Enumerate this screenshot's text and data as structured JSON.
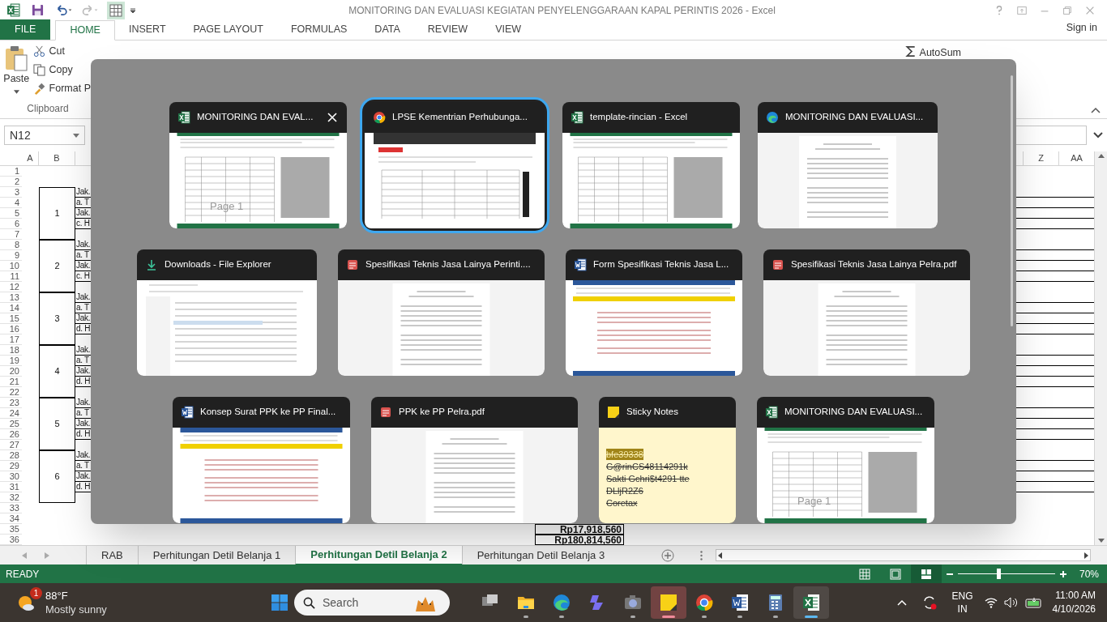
{
  "excel": {
    "title": "MONITORING DAN EVALUASI KEGIATAN PENYELENGGARAAN KAPAL PERINTIS 2026 - Excel",
    "ribbon_tabs": [
      {
        "label": "FILE",
        "kind": "file",
        "selected": false
      },
      {
        "label": "HOME",
        "kind": "tab",
        "selected": true
      },
      {
        "label": "INSERT",
        "kind": "tab",
        "selected": false
      },
      {
        "label": "PAGE LAYOUT",
        "kind": "tab",
        "selected": false
      },
      {
        "label": "FORMULAS",
        "kind": "tab",
        "selected": false
      },
      {
        "label": "DATA",
        "kind": "tab",
        "selected": false
      },
      {
        "label": "REVIEW",
        "kind": "tab",
        "selected": false
      },
      {
        "label": "VIEW",
        "kind": "tab",
        "selected": false
      }
    ],
    "sign_in": "Sign in",
    "clipboard": {
      "paste": "Paste",
      "cut": "Cut",
      "copy": "Copy",
      "format_painter": "Format P",
      "group": "Clipboard"
    },
    "autosum": "AutoSum",
    "name_box": "N12",
    "columns": [
      "A",
      "B"
    ],
    "right_columns": [
      "Z",
      "AA"
    ],
    "row_numbers": [
      "1",
      "2",
      "3",
      "4",
      "5",
      "6",
      "7",
      "8",
      "9",
      "10",
      "11",
      "12",
      "13",
      "14",
      "15",
      "16",
      "17",
      "18",
      "19",
      "20",
      "21",
      "22",
      "23",
      "24",
      "25",
      "26",
      "27",
      "28",
      "29",
      "30",
      "31",
      "32",
      "33",
      "34",
      "35",
      "36"
    ],
    "groups": [
      {
        "number": "1",
        "lines": [
          "Jak.",
          "a. T",
          "Jak.",
          "c. H"
        ]
      },
      {
        "number": "2",
        "lines": [
          "Jak.",
          "a. T",
          "Jak.",
          "c. H"
        ]
      },
      {
        "number": "3",
        "lines": [
          "Jak.",
          "a. T",
          "Jak.",
          "d. H"
        ]
      },
      {
        "number": "4",
        "lines": [
          "Jak.",
          "a. T",
          "Jak.",
          "d. H"
        ]
      },
      {
        "number": "5",
        "lines": [
          "Jak.",
          "a. T",
          "Jak.",
          "d. H"
        ]
      },
      {
        "number": "6",
        "lines": [
          "Jak.",
          "a. T",
          "Jak.",
          "d. H"
        ]
      }
    ],
    "totals": [
      "Rp17,918,560",
      "Rp180,814,560"
    ],
    "sheet_tabs": [
      {
        "label": "RAB",
        "selected": false
      },
      {
        "label": "Perhitungan Detil Belanja 1",
        "selected": false
      },
      {
        "label": "Perhitungan Detil Belanja 2",
        "selected": true
      },
      {
        "label": "Perhitungan Detil Belanja 3",
        "selected": false
      }
    ],
    "status": "READY",
    "view_buttons": [
      {
        "kind": "normal",
        "selected": false
      },
      {
        "kind": "page_layout",
        "selected": false
      },
      {
        "kind": "page_break",
        "selected": true
      }
    ],
    "zoom": {
      "level": 0.42,
      "reading": "70%"
    }
  },
  "switcher": {
    "windows": [
      {
        "title": "MONITORING DAN EVAL...",
        "kind": "excel",
        "selected": false,
        "hovered": true,
        "page_label": "Page 1"
      },
      {
        "title": "LPSE Kementrian Perhubunga...",
        "kind": "chrome",
        "selected": true,
        "hovered": false
      },
      {
        "title": "template-rincian - Excel",
        "kind": "excel",
        "selected": false,
        "hovered": false
      },
      {
        "title": "MONITORING DAN EVALUASI...",
        "kind": "edge",
        "selected": false,
        "hovered": false
      },
      {
        "title": "Downloads - File Explorer",
        "kind": "explorer",
        "selected": false,
        "hovered": false
      },
      {
        "title": "Spesifikasi Teknis Jasa Lainya Perinti....",
        "kind": "pdf",
        "selected": false,
        "hovered": false
      },
      {
        "title": "Form Spesifikasi Teknis Jasa L...",
        "kind": "word",
        "selected": false,
        "hovered": false
      },
      {
        "title": "Spesifikasi Teknis Jasa Lainya Pelra.pdf",
        "kind": "pdf",
        "selected": false,
        "hovered": false
      },
      {
        "title": "Konsep Surat PPK ke PP Final...",
        "kind": "word",
        "selected": false,
        "hovered": false
      },
      {
        "title": "PPK ke PP Pelra.pdf",
        "kind": "pdf",
        "selected": false,
        "hovered": false
      },
      {
        "title": "Sticky Notes",
        "kind": "sticky",
        "selected": false,
        "hovered": false,
        "note_lines": [
          {
            "text": "bfe39338",
            "highlighted": true,
            "struck": true
          },
          {
            "text": "G@rinCS48114291k",
            "highlighted": false,
            "struck": true
          },
          {
            "text": "Sakti Gchri$t4291 tte",
            "highlighted": false,
            "struck": true
          },
          {
            "text": "DLljR2Z6",
            "highlighted": false,
            "struck": true
          },
          {
            "text": "Coretax",
            "highlighted": false,
            "struck": true
          }
        ]
      },
      {
        "title": "MONITORING DAN EVALUASI...",
        "kind": "excel",
        "selected": false,
        "hovered": false,
        "page_label": "Page 1"
      }
    ]
  },
  "taskbar": {
    "weather": {
      "temperature": "88°F",
      "condition": "Mostly sunny",
      "badge": "1"
    },
    "search_placeholder": "Search",
    "apps": [
      {
        "kind": "taskview",
        "running": false,
        "focused": false,
        "attention": false
      },
      {
        "kind": "explorer",
        "running": true,
        "focused": false,
        "attention": false
      },
      {
        "kind": "edge",
        "running": true,
        "focused": false,
        "attention": false
      },
      {
        "kind": "copilot",
        "running": false,
        "focused": false,
        "attention": false
      },
      {
        "kind": "camera",
        "running": true,
        "focused": false,
        "attention": false
      },
      {
        "kind": "sticky",
        "running": true,
        "focused": false,
        "attention": true
      },
      {
        "kind": "chrome",
        "running": true,
        "focused": false,
        "attention": false
      },
      {
        "kind": "word",
        "running": true,
        "focused": false,
        "attention": false
      },
      {
        "kind": "calculator",
        "running": true,
        "focused": false,
        "attention": false
      },
      {
        "kind": "excel",
        "running": true,
        "focused": true,
        "attention": false
      }
    ],
    "language": "ENG",
    "region": "IN",
    "time": "11:00 AM",
    "date": "4/10/2026"
  }
}
